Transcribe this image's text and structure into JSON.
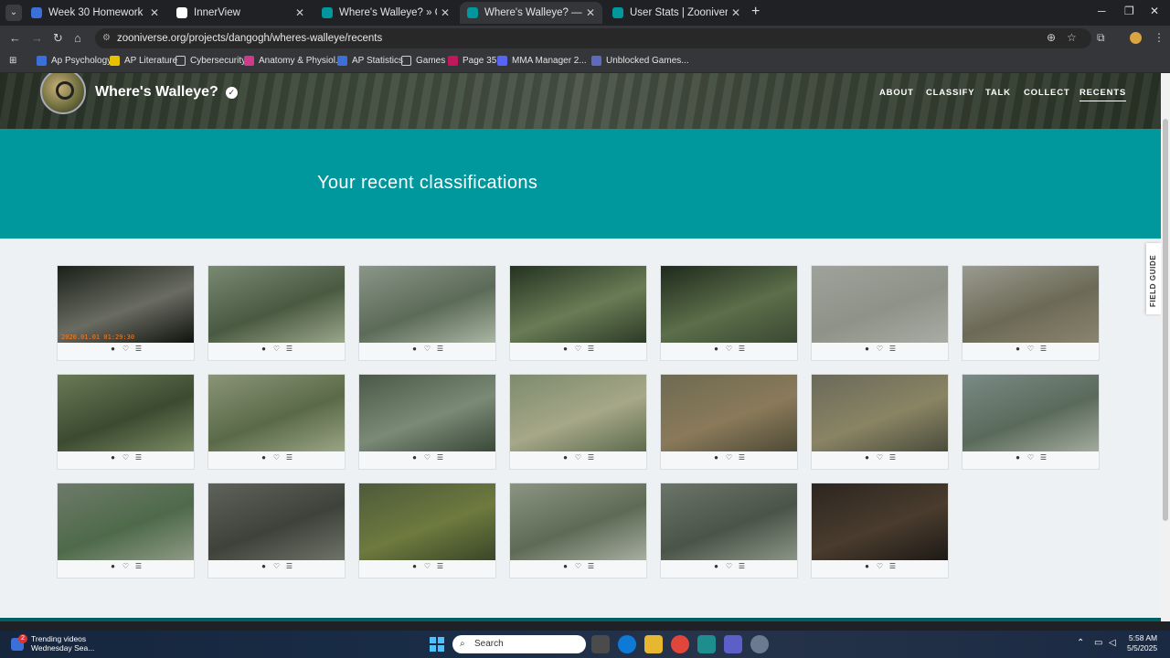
{
  "browser": {
    "tabs": [
      {
        "title": "Week 30 Homework",
        "active": false,
        "favicon_color": "#3b6fd9"
      },
      {
        "title": "InnerView",
        "active": false,
        "favicon_color": "#ffffff"
      },
      {
        "title": "Where's Walleye? » Classify —",
        "active": false,
        "favicon_color": "#00979d"
      },
      {
        "title": "Where's Walleye? — Zooniverse",
        "active": true,
        "favicon_color": "#00979d"
      },
      {
        "title": "User Stats | Zooniverse",
        "active": false,
        "favicon_color": "#00979d"
      }
    ],
    "url": "zooniverse.org/projects/dangogh/wheres-walleye/recents",
    "bookmarks": [
      {
        "label": "Ap Psychology",
        "icon": "doc-icon",
        "color": "#3b6fd9"
      },
      {
        "label": "AP Literature",
        "icon": "doc-icon",
        "color": "#e6c300"
      },
      {
        "label": "Cybersecurity",
        "icon": "folder-icon",
        "color": ""
      },
      {
        "label": "Anatomy & Physiol...",
        "icon": "doc-icon",
        "color": "#d03a8c"
      },
      {
        "label": "AP Statistics",
        "icon": "doc-icon",
        "color": "#3b6fd9"
      },
      {
        "label": "Games",
        "icon": "folder-icon",
        "color": ""
      },
      {
        "label": "Page 35",
        "icon": "p-icon",
        "color": "#c2185b"
      },
      {
        "label": "MMA Manager 2...",
        "icon": "discord-icon",
        "color": "#5865f2"
      },
      {
        "label": "Unblocked Games...",
        "icon": "grid-icon",
        "color": "#5c6bc0"
      }
    ]
  },
  "project": {
    "title": "Where's Walleye?",
    "nav": [
      "ABOUT",
      "CLASSIFY",
      "TALK",
      "COLLECT",
      "RECENTS"
    ],
    "active_nav": "RECENTS"
  },
  "page": {
    "heading": "Your recent classifications",
    "field_guide": "FIELD GUIDE",
    "accent_color": "#00979d"
  },
  "recents": [
    {
      "stamp": "2020.01.01 01:29:30"
    },
    {
      "stamp": ""
    },
    {
      "stamp": ""
    },
    {
      "stamp": ""
    },
    {
      "stamp": ""
    },
    {
      "stamp": ""
    },
    {
      "stamp": ""
    },
    {
      "stamp": ""
    },
    {
      "stamp": ""
    },
    {
      "stamp": ""
    },
    {
      "stamp": ""
    },
    {
      "stamp": ""
    },
    {
      "stamp": ""
    },
    {
      "stamp": ""
    },
    {
      "stamp": ""
    },
    {
      "stamp": ""
    },
    {
      "stamp": ""
    },
    {
      "stamp": ""
    },
    {
      "stamp": ""
    },
    {
      "stamp": ""
    }
  ],
  "card_actions": [
    "info-icon",
    "heart-icon",
    "collection-icon"
  ],
  "taskbar": {
    "news_title": "Trending videos",
    "news_sub": "Wednesday Sea...",
    "news_badge": "2",
    "search_placeholder": "Search",
    "time": "5:58 AM",
    "date": "5/5/2025"
  }
}
